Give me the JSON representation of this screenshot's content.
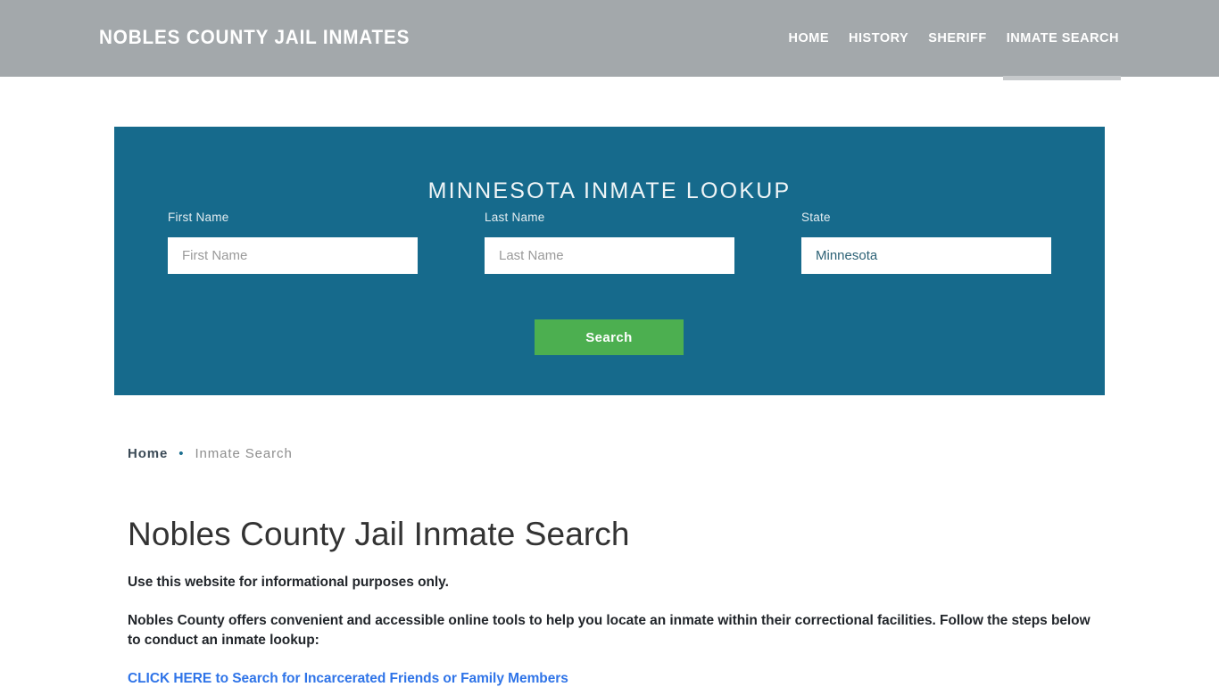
{
  "header": {
    "brand": "Nobles County Jail Inmates",
    "background_color": "#a3a8ab",
    "nav": [
      {
        "label": "Home",
        "active": false
      },
      {
        "label": "History",
        "active": false
      },
      {
        "label": "Sheriff",
        "active": false
      },
      {
        "label": "Inmate Search",
        "active": true
      }
    ]
  },
  "lookup": {
    "title": "Minnesota Inmate Lookup",
    "panel_color": "#166a8c",
    "fields": {
      "first_name": {
        "label": "First Name",
        "placeholder": "First Name",
        "value": ""
      },
      "last_name": {
        "label": "Last Name",
        "placeholder": "Last Name",
        "value": ""
      },
      "state": {
        "label": "State",
        "selected": "Minnesota",
        "options": [
          "Minnesota"
        ]
      }
    },
    "search_button": {
      "label": "Search",
      "color": "#4caf50"
    }
  },
  "breadcrumb": {
    "home": "Home",
    "separator": "•",
    "current": "Inmate Search"
  },
  "main": {
    "title": "Nobles County Jail Inmate Search",
    "paragraph_1": "Use this website for informational purposes only.",
    "paragraph_2": "Nobles County offers convenient and accessible online tools to help you locate an inmate within their correctional facilities. Follow the steps below to conduct an inmate lookup:",
    "cta_link": "CLICK HERE to Search for Incarcerated Friends or Family Members",
    "link_color": "#2f74e8"
  }
}
